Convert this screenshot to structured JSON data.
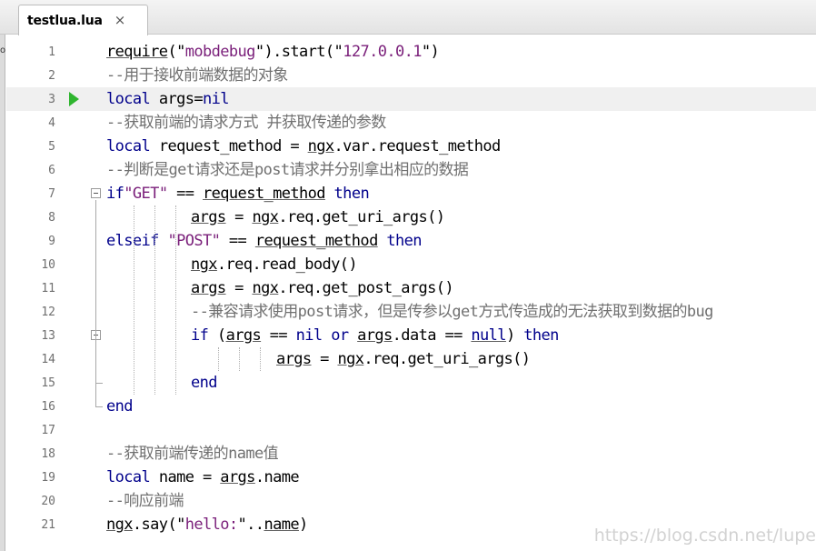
{
  "tab": {
    "label": "testlua.lua",
    "close": "×"
  },
  "left_mark": "o",
  "watermark": "https://blog.csdn.net/lupe",
  "lines": [
    {
      "n": "1",
      "parts": [
        [
          "fn u",
          "require"
        ],
        [
          "fn",
          "(\""
        ],
        [
          "str",
          "mobdebug"
        ],
        [
          "fn",
          "\").start(\""
        ],
        [
          "str",
          "127.0.0.1"
        ],
        [
          "fn",
          "\")"
        ]
      ]
    },
    {
      "n": "2",
      "parts": [
        [
          "cmt",
          "--用于接收前端数据的对象"
        ]
      ]
    },
    {
      "n": "3",
      "parts": [
        [
          "kw",
          "local"
        ],
        [
          "fn",
          " args="
        ],
        [
          "kw",
          "nil"
        ]
      ]
    },
    {
      "n": "4",
      "parts": [
        [
          "cmt",
          "--获取前端的请求方式 并获取传递的参数"
        ]
      ]
    },
    {
      "n": "5",
      "parts": [
        [
          "kw",
          "local"
        ],
        [
          "fn",
          " request_method = "
        ],
        [
          "fn u",
          "ngx"
        ],
        [
          "fn",
          ".var.request_method"
        ]
      ]
    },
    {
      "n": "6",
      "parts": [
        [
          "cmt",
          "--判断是get请求还是post请求并分别拿出相应的数据"
        ]
      ]
    },
    {
      "n": "7",
      "parts": [
        [
          "kw",
          "if"
        ],
        [
          "str",
          "\"GET\""
        ],
        [
          "fn",
          " == "
        ],
        [
          "fn u",
          "request_method"
        ],
        [
          "fn",
          " "
        ],
        [
          "kw",
          "then"
        ]
      ]
    },
    {
      "n": "8",
      "parts": [
        [
          "fn u",
          "args"
        ],
        [
          "fn",
          " = "
        ],
        [
          "fn u",
          "ngx"
        ],
        [
          "fn",
          ".req.get_uri_args()"
        ]
      ]
    },
    {
      "n": "9",
      "parts": [
        [
          "kw",
          "elseif"
        ],
        [
          "fn",
          " "
        ],
        [
          "str",
          "\"POST\""
        ],
        [
          "fn",
          " == "
        ],
        [
          "fn u",
          "request_method"
        ],
        [
          "fn",
          " "
        ],
        [
          "kw",
          "then"
        ]
      ]
    },
    {
      "n": "10",
      "parts": [
        [
          "fn u",
          "ngx"
        ],
        [
          "fn",
          ".req.read_body()"
        ]
      ]
    },
    {
      "n": "11",
      "parts": [
        [
          "fn u",
          "args"
        ],
        [
          "fn",
          " = "
        ],
        [
          "fn u",
          "ngx"
        ],
        [
          "fn",
          ".req.get_post_args()"
        ]
      ]
    },
    {
      "n": "12",
      "parts": [
        [
          "cmt",
          "--兼容请求使用post请求，但是传参以get方式传造成的无法获取到数据的bug"
        ]
      ]
    },
    {
      "n": "13",
      "parts": [
        [
          "kw",
          "if"
        ],
        [
          "fn",
          " ("
        ],
        [
          "fn u",
          "args"
        ],
        [
          "fn",
          " == "
        ],
        [
          "kw",
          "nil"
        ],
        [
          "fn",
          " "
        ],
        [
          "kw",
          "or"
        ],
        [
          "fn",
          " "
        ],
        [
          "fn u",
          "args"
        ],
        [
          "fn",
          ".data == "
        ],
        [
          "kw u",
          "null"
        ],
        [
          "fn",
          ") "
        ],
        [
          "kw",
          "then"
        ]
      ]
    },
    {
      "n": "14",
      "parts": [
        [
          "fn u",
          "args"
        ],
        [
          "fn",
          " = "
        ],
        [
          "fn u",
          "ngx"
        ],
        [
          "fn",
          ".req.get_uri_args()"
        ]
      ]
    },
    {
      "n": "15",
      "parts": [
        [
          "kw",
          "end"
        ]
      ]
    },
    {
      "n": "16",
      "parts": [
        [
          "kw",
          "end"
        ]
      ]
    },
    {
      "n": "17",
      "parts": []
    },
    {
      "n": "18",
      "parts": [
        [
          "cmt",
          "--获取前端传递的name值"
        ]
      ]
    },
    {
      "n": "19",
      "parts": [
        [
          "kw",
          "local"
        ],
        [
          "fn",
          " name = "
        ],
        [
          "fn u",
          "args"
        ],
        [
          "fn",
          ".name"
        ]
      ]
    },
    {
      "n": "20",
      "parts": [
        [
          "cmt",
          "--响应前端"
        ]
      ]
    },
    {
      "n": "21",
      "parts": [
        [
          "fn u",
          "ngx"
        ],
        [
          "fn",
          ".say(\""
        ],
        [
          "str",
          "hello:"
        ],
        [
          "fn",
          "\".."
        ],
        [
          "fn u",
          "name"
        ],
        [
          "fn",
          ")"
        ]
      ]
    }
  ]
}
